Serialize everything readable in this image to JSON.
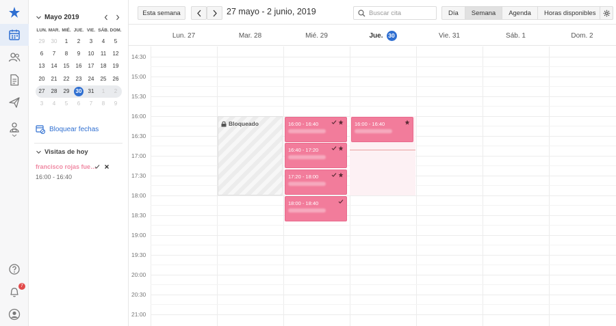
{
  "rail": {
    "icons": [
      "app-logo-icon",
      "calendar-icon",
      "patients-icon",
      "document-icon",
      "send-icon",
      "user-settings-icon",
      "help-icon",
      "bell-icon",
      "profile-icon"
    ],
    "notification_count": "7"
  },
  "mini_calendar": {
    "title": "Mayo 2019",
    "weekdays": [
      "LUN.",
      "MAR.",
      "MIÉ.",
      "JUE.",
      "VIE.",
      "SÁB.",
      "DOM."
    ],
    "weeks": [
      [
        "29",
        "30",
        "1",
        "2",
        "3",
        "4",
        "5"
      ],
      [
        "6",
        "7",
        "8",
        "9",
        "10",
        "11",
        "12"
      ],
      [
        "13",
        "14",
        "15",
        "16",
        "17",
        "18",
        "19"
      ],
      [
        "20",
        "21",
        "22",
        "23",
        "24",
        "25",
        "26"
      ],
      [
        "27",
        "28",
        "29",
        "30",
        "31",
        "1",
        "2"
      ],
      [
        "3",
        "4",
        "5",
        "6",
        "7",
        "8",
        "9"
      ]
    ]
  },
  "sidebar": {
    "block_dates_label": "Bloquear fechas",
    "visits_title": "Visitas de hoy",
    "visit_name": "francisco rojas fuen...",
    "visit_time": "16:00 - 16:40"
  },
  "toolbar": {
    "this_week": "Esta semana",
    "range": "27 mayo - 2 junio, 2019",
    "search_placeholder": "Buscar cita",
    "views": [
      "Día",
      "Semana",
      "Agenda",
      "Horas disponibles"
    ],
    "active_view": "Semana"
  },
  "days": [
    {
      "label": "Lun. 27"
    },
    {
      "label": "Mar. 28"
    },
    {
      "label": "Mié. 29"
    },
    {
      "label": "Jue.",
      "num": "30",
      "today": true
    },
    {
      "label": "Vie. 31"
    },
    {
      "label": "Sáb. 1"
    },
    {
      "label": "Dom. 2"
    }
  ],
  "times": [
    "14:30",
    "15:00",
    "15:30",
    "16:00",
    "16:30",
    "17:00",
    "17:30",
    "18:00",
    "18:30",
    "19:00",
    "19:30",
    "20:00",
    "20:30",
    "21:00"
  ],
  "blocked": {
    "label": "Bloqueado"
  },
  "events": [
    {
      "time": "16:00 - 16:40"
    },
    {
      "time": "16:40 - 17:20"
    },
    {
      "time": "17:20 - 18:00"
    },
    {
      "time": "18:00 - 18:40"
    },
    {
      "time": "16:00 - 16:40"
    }
  ],
  "colors": {
    "accent": "#2f6fd1",
    "event": "#f27c9b",
    "visit_name": "#f08aa4",
    "badge": "#e24a4a"
  }
}
